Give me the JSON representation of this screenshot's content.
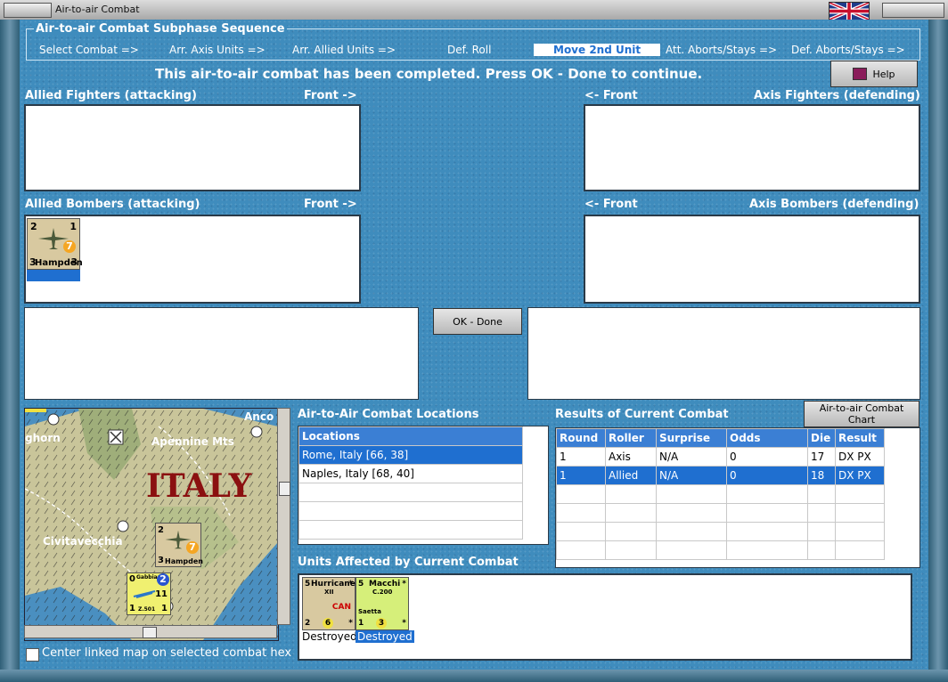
{
  "window": {
    "title": "Air-to-air Combat"
  },
  "sequence": {
    "legend": "Air-to-air Combat Subphase Sequence",
    "steps": [
      "Select Combat =>",
      "Arr. Axis Units =>",
      "Arr. Allied Units =>",
      "Def. Roll",
      "Move 2nd Unit",
      "Att. Aborts/Stays =>",
      "Def. Aborts/Stays =>"
    ],
    "active_index": 4
  },
  "message": "This air-to-air combat has been completed.  Press OK - Done to continue.",
  "help_label": "Help",
  "allied_fighters": {
    "label": "Allied Fighters (attacking)",
    "front": "Front ->"
  },
  "axis_fighters": {
    "label": "Axis Fighters (defending)",
    "front": "<- Front"
  },
  "allied_bombers": {
    "label": "Allied Bombers (attacking)",
    "front": "Front ->"
  },
  "axis_bombers": {
    "label": "Axis Bombers (defending)",
    "front": "<- Front"
  },
  "hampden": {
    "tl": "2",
    "tr": "1",
    "bl": "3",
    "br": "3",
    "name": "Hampden",
    "circle": "7"
  },
  "ok_label": "OK - Done",
  "map": {
    "title_big": "ITALY",
    "labels": [
      "ghorn",
      "Apennine Mts",
      "Anco",
      "Civitavecchia"
    ],
    "hampden_small": {
      "tl": "2",
      "bl": "3",
      "name": "Hampden",
      "circle": "7"
    },
    "gabbiano": {
      "tl": "0",
      "name": "Gabbiano",
      "circle": "2",
      "num": "11",
      "b1": "1",
      "bname": "Z.501",
      "b2": "1"
    }
  },
  "center_map_label": "Center linked map on selected combat hex",
  "locations": {
    "title": "Air-to-Air Combat Locations",
    "header": "Locations",
    "rows": [
      "Rome, Italy [66, 38]",
      "Naples, Italy [68, 40]",
      "",
      "",
      ""
    ],
    "selected_index": 0
  },
  "results": {
    "title": "Results of Current Combat",
    "chart_button": "Air-to-air Combat Chart",
    "columns": [
      "Round",
      "Roller",
      "Surprise",
      "Odds",
      "Die",
      "Result"
    ],
    "rows": [
      [
        "1",
        "Axis",
        "N/A",
        "0",
        "17",
        "DX PX"
      ],
      [
        "1",
        "Allied",
        "N/A",
        "0",
        "18",
        "DX PX"
      ],
      [
        "",
        "",
        "",
        "",
        "",
        ""
      ],
      [
        "",
        "",
        "",
        "",
        "",
        ""
      ],
      [
        "",
        "",
        "",
        "",
        "",
        ""
      ],
      [
        "",
        "",
        "",
        "",
        "",
        ""
      ]
    ],
    "selected_index": 1
  },
  "affected": {
    "title": "Units Affected by Current Combat",
    "units": [
      {
        "name": "Hurricane",
        "sub": "XII",
        "tag": "CAN",
        "tl": "5",
        "bl": "2",
        "circle": "6",
        "star": "*",
        "status": "Destroyed"
      },
      {
        "name": "Macchi",
        "sub": "C.200",
        "sub2": "Saetta",
        "tl": "5",
        "bl": "1",
        "circle": "3",
        "star": "*",
        "status": "Destroyed"
      }
    ]
  }
}
